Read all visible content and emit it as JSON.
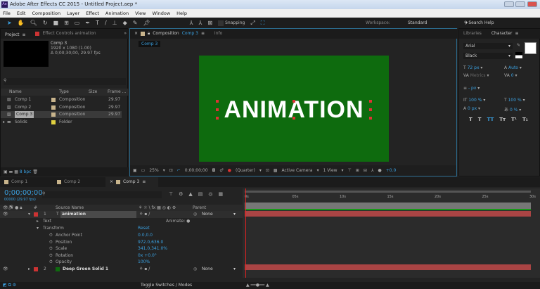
{
  "window": {
    "title": "Adobe After Effects CC 2015 - Untitled Project.aep *",
    "logo": "Ae"
  },
  "menu": [
    "File",
    "Edit",
    "Composition",
    "Layer",
    "Effect",
    "Animation",
    "View",
    "Window",
    "Help"
  ],
  "toolbar": {
    "tools": [
      "selection-tool",
      "hand-tool",
      "zoom-tool",
      "rotate-tool",
      "camera-tool",
      "pan-behind-tool",
      "rectangle-tool",
      "pen-tool",
      "type-tool",
      "brush-tool",
      "clone-stamp-tool",
      "eraser-tool",
      "roto-brush-tool",
      "puppet-pin-tool"
    ],
    "snapping": "Snapping",
    "workspace_label": "Workspace:",
    "workspace_value": "Standard",
    "search": "Search Help"
  },
  "project": {
    "tab": "Project",
    "effect_tab": "Effect Controls animation",
    "comp_name": "Comp 3",
    "resolution": "1920 x 1080 (1.00)",
    "duration": "Δ 0;00;30;00, 29.97 fps",
    "columns": [
      "Name",
      "Type",
      "Size",
      "Frame ..."
    ],
    "items": [
      {
        "name": "Comp 1",
        "type": "Composition",
        "fps": "29.97",
        "color": "#c8b48c"
      },
      {
        "name": "Comp 2",
        "type": "Composition",
        "fps": "29.97",
        "color": "#c8b48c"
      },
      {
        "name": "Comp 3",
        "type": "Composition",
        "fps": "29.97",
        "color": "#c8b48c",
        "selected": true
      },
      {
        "name": "Solids",
        "type": "Folder",
        "fps": "",
        "color": "#e0d040"
      }
    ],
    "bpc": "8 bpc"
  },
  "composition": {
    "tab_prefix": "Composition",
    "tab_comp": "Comp 3",
    "info_tab": "Info",
    "breadcrumb": "Comp 3",
    "text": "ANIMATION",
    "bg_color": "#0e6b0e",
    "zoom": "25%",
    "timecode": "0;00;00;00",
    "resolution": "(Quarter)",
    "camera": "Active Camera",
    "view": "1 View",
    "exposure": "+0.0"
  },
  "character": {
    "libraries_tab": "Libraries",
    "tab": "Character",
    "font": "Arial",
    "style": "Black",
    "size": "72 px",
    "leading": "Auto",
    "kerning": "Metrics",
    "tracking": "0",
    "stroke": "- px",
    "vscale": "100 %",
    "hscale": "100 %",
    "baseline": "0 px",
    "tsume": "0 %",
    "styles": [
      "T",
      "T",
      "TT",
      "Tт",
      "T¹",
      "T₁"
    ]
  },
  "timeline": {
    "tabs": [
      "Comp 1",
      "Comp 2",
      "Comp 3"
    ],
    "timecode": "0;00;00;00",
    "fps": "00000 (29.97 fps)",
    "headers": {
      "source": "Source Name",
      "parent": "Parent"
    },
    "ruler": [
      "0s",
      "05s",
      "10s",
      "15s",
      "20s",
      "25s",
      "30s"
    ],
    "layers": [
      {
        "num": "1",
        "name": "animation",
        "parent": "None"
      },
      {
        "num": "2",
        "name": "Deep Green Solid 1",
        "parent": "None"
      }
    ],
    "text_group": "Text",
    "animate": "Animate:",
    "transform": "Transform",
    "reset": "Reset",
    "props": [
      {
        "name": "Anchor Point",
        "value": "0.0,0.0"
      },
      {
        "name": "Position",
        "value": "972.0,636.0"
      },
      {
        "name": "Scale",
        "value": "341.0,341.0%"
      },
      {
        "name": "Rotation",
        "value": "0x +0.0°"
      },
      {
        "name": "Opacity",
        "value": "100%"
      }
    ],
    "toggle": "Toggle Switches / Modes"
  }
}
